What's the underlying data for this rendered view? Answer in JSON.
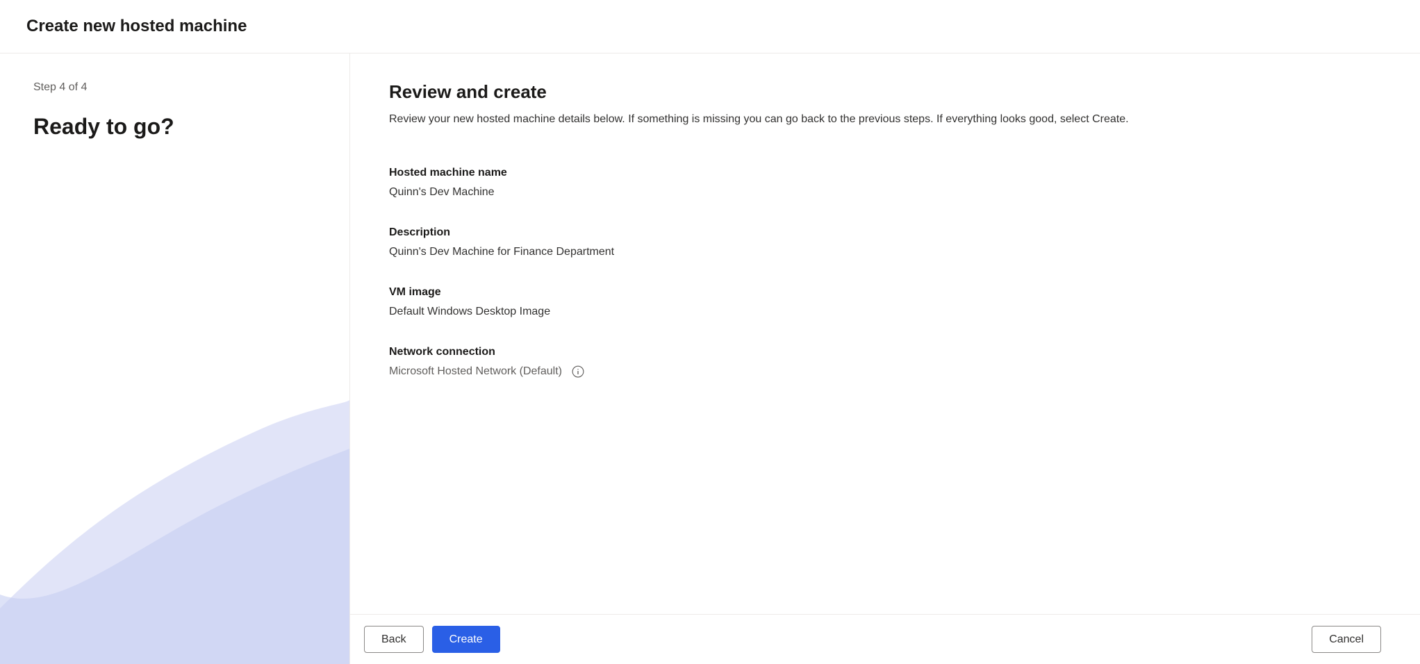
{
  "header": {
    "title": "Create new hosted machine"
  },
  "sidebar": {
    "step_indicator": "Step 4 of 4",
    "title": "Ready to go?"
  },
  "main": {
    "title": "Review and create",
    "subtitle": "Review your new hosted machine details below. If something is missing you can go back to the previous steps. If everything looks good, select Create.",
    "fields": {
      "machine_name": {
        "label": "Hosted machine name",
        "value": "Quinn's Dev Machine"
      },
      "description": {
        "label": "Description",
        "value": "Quinn's Dev Machine for Finance Department"
      },
      "vm_image": {
        "label": "VM image",
        "value": "Default Windows Desktop Image"
      },
      "network": {
        "label": "Network connection",
        "value": "Microsoft Hosted Network (Default)"
      }
    }
  },
  "footer": {
    "back_label": "Back",
    "create_label": "Create",
    "cancel_label": "Cancel"
  }
}
